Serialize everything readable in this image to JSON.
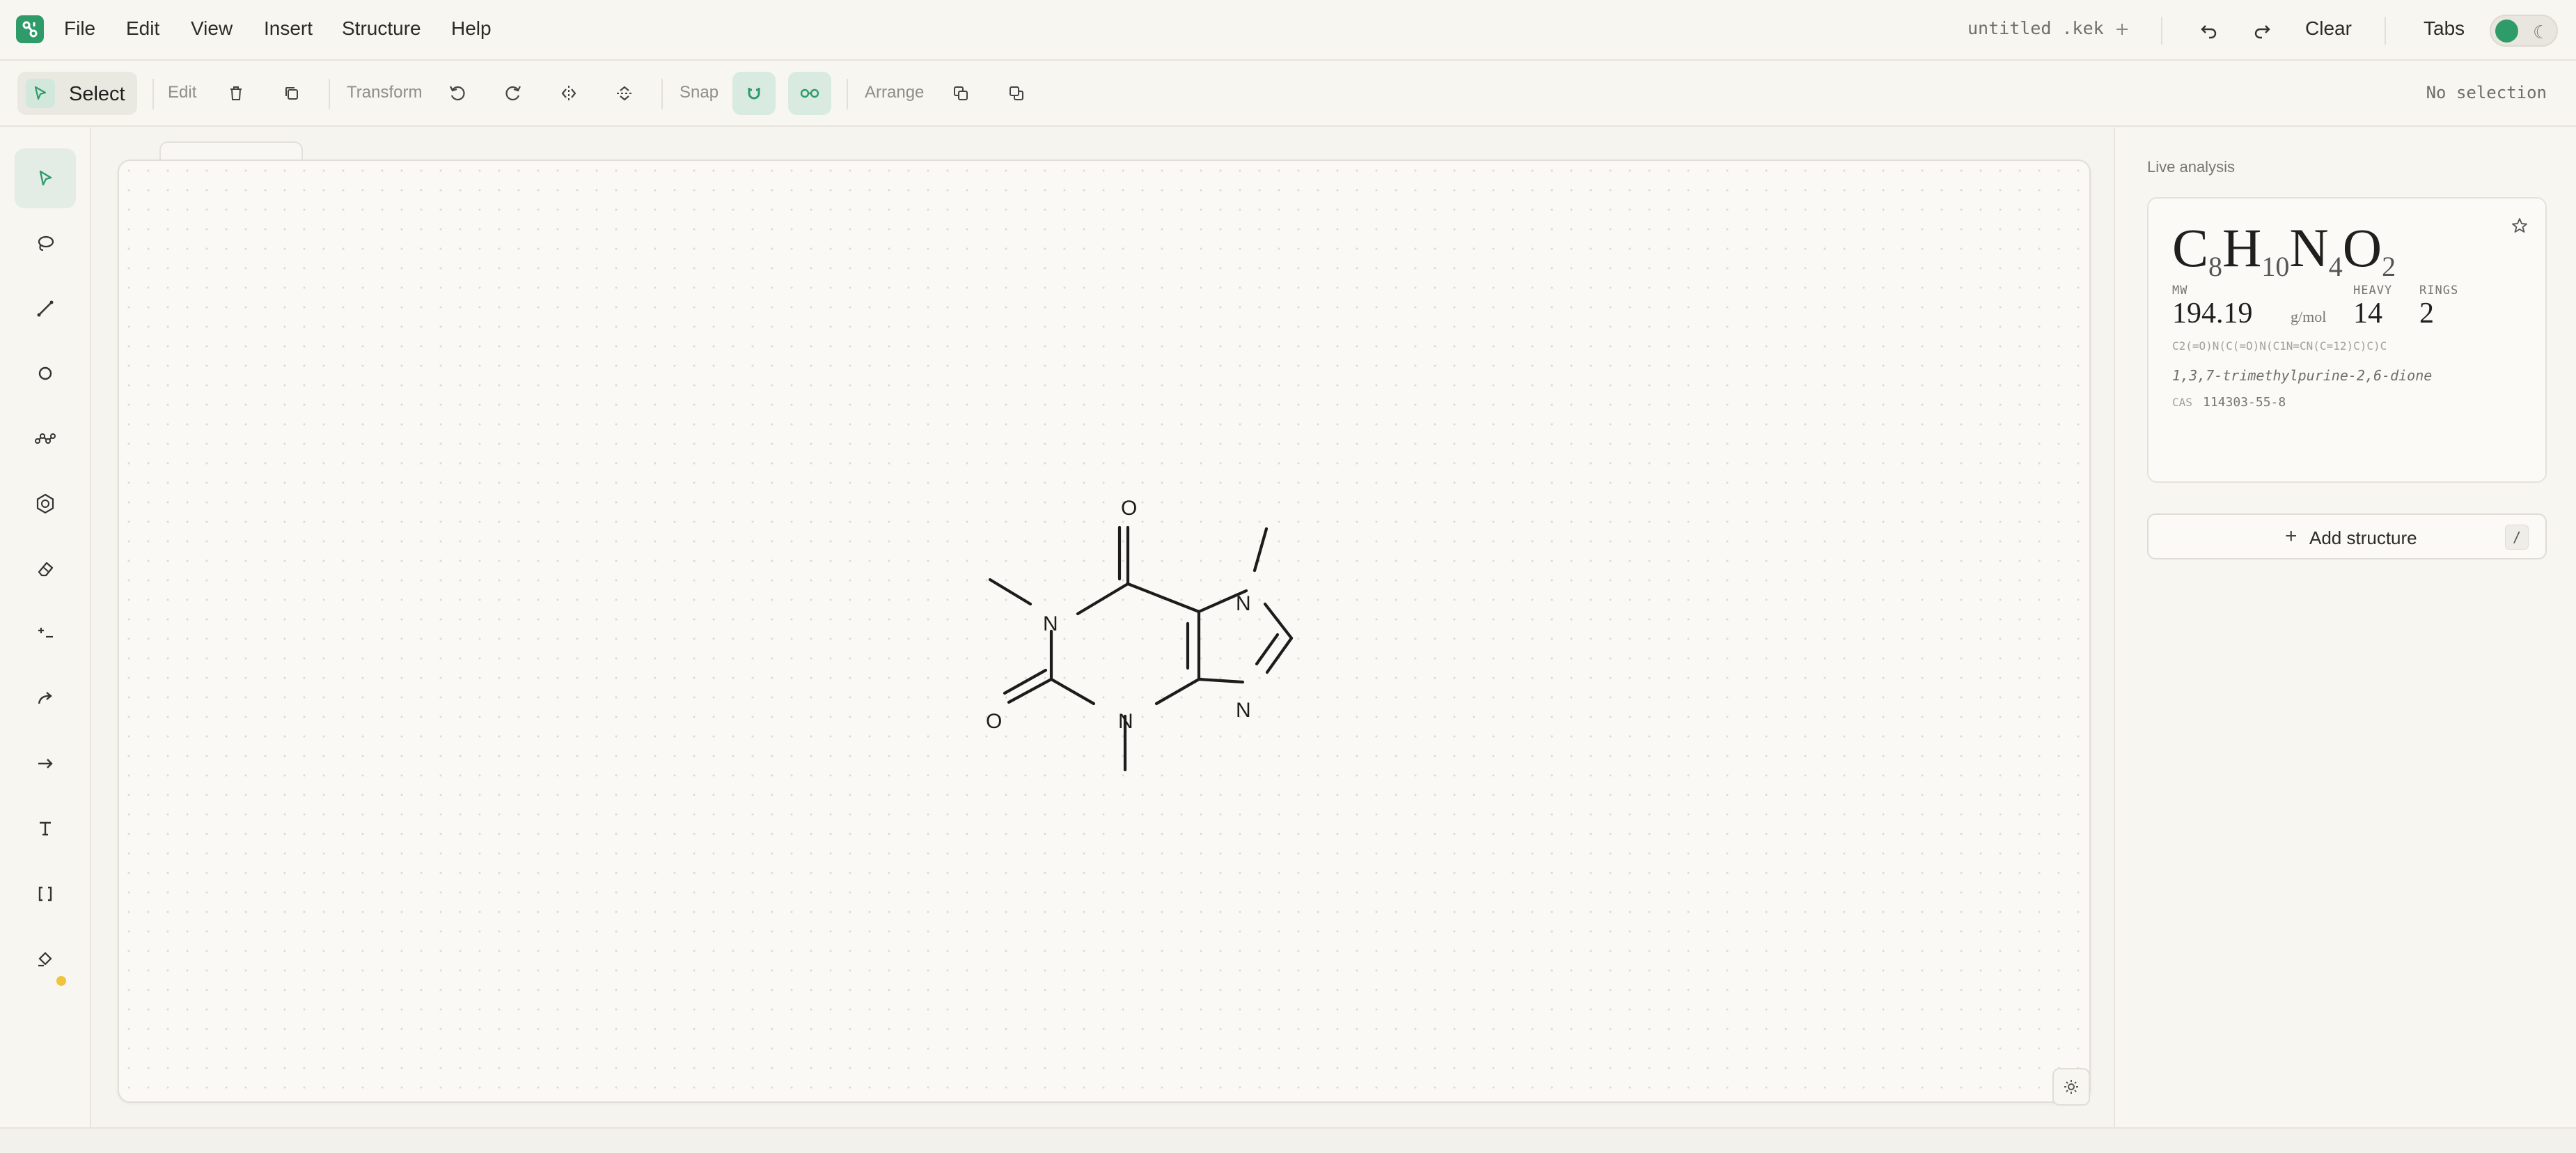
{
  "menubar": {
    "items": [
      "File",
      "Edit",
      "View",
      "Insert",
      "Structure",
      "Help"
    ],
    "file_name": "untitled .kek",
    "clear_label": "Clear",
    "tabs_label": "Tabs"
  },
  "toolbar": {
    "select_label": "Select",
    "edit_label": "Edit",
    "transform_label": "Transform",
    "snap_label": "Snap",
    "arrange_label": "Arrange",
    "status": "No selection"
  },
  "rail": {
    "tools": [
      "select-arrow-icon",
      "lasso-icon",
      "bond-icon",
      "atom-icon",
      "chain-icon",
      "ring-icon",
      "eraser-icon",
      "charge-icon",
      "curved-arrow-icon",
      "reaction-arrow-icon",
      "text-icon",
      "bracket-icon",
      "fill-icon"
    ],
    "active_tool": "select-arrow-icon"
  },
  "molecule": {
    "atoms": [
      "O",
      "N",
      "N",
      "O",
      "N",
      "N"
    ]
  },
  "analysis": {
    "title": "Live analysis",
    "formula": {
      "c": "C",
      "c_n": "8",
      "h": "H",
      "h_n": "10",
      "n": "N",
      "n_n": "4",
      "o": "O",
      "o_n": "2"
    },
    "mw_label": "MW",
    "mw_value": "194.19",
    "mw_unit": "g/mol",
    "heavy_label": "HEAVY",
    "heavy_value": "14",
    "rings_label": "RINGS",
    "rings_value": "2",
    "smiles": "C2(=O)N(C(=O)N(C1N=CN(C=12)C)C)C",
    "iupac": "1,3,7-trimethylpurine-2,6-dione",
    "cas_label": "CAS",
    "cas_value": "114303-55-8"
  },
  "add_structure": {
    "label": "Add structure",
    "shortcut": "/"
  },
  "colors": {
    "accent": "#2e9b69",
    "background": "#f5f4ef",
    "warning_dot": "#f0c33a"
  }
}
